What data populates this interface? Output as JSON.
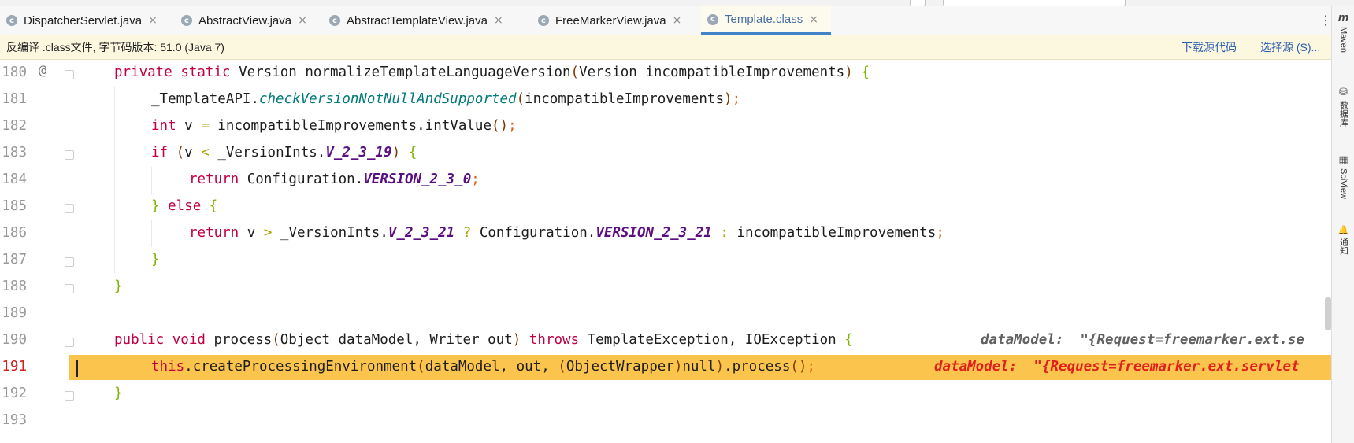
{
  "tabs": [
    {
      "label": "DispatcherServlet.java",
      "icon": "class-c-icon",
      "active": false
    },
    {
      "label": "AbstractView.java",
      "icon": "class-c-icon",
      "active": false
    },
    {
      "label": "AbstractTemplateView.java",
      "icon": "class-c-icon",
      "active": false
    },
    {
      "label": "FreeMarkerView.java",
      "icon": "class-c-icon",
      "active": false
    },
    {
      "label": "Template.class",
      "icon": "class-c-icon",
      "active": true
    }
  ],
  "tab_close_glyph": "×",
  "tab_menu_glyph": "⋮",
  "infobar": {
    "message": "反编译 .class文件, 字节码版本: 51.0 (Java 7)",
    "download_link": "下载源代码",
    "choose_link": "选择源 (S)..."
  },
  "right_tools": [
    {
      "label": "Maven",
      "icon": "maven-icon",
      "glyph": "m"
    },
    {
      "label": "数据库",
      "icon": "database-icon",
      "glyph": "⛁"
    },
    {
      "label": "SciView",
      "icon": "sciview-icon",
      "glyph": "▦"
    },
    {
      "label": "通知",
      "icon": "bell-icon",
      "glyph": "🔔"
    }
  ],
  "gutter_marker": "@",
  "lines": [
    {
      "num": "180",
      "text": "private static Version normalizeTemplateLanguageVersion(Version incompatibleImprovements) {"
    },
    {
      "num": "181",
      "text": "_TemplateAPI.checkVersionNotNullAndSupported(incompatibleImprovements);"
    },
    {
      "num": "182",
      "text": "int v = incompatibleImprovements.intValue();"
    },
    {
      "num": "183",
      "text": "if (v < _VersionInts.V_2_3_19) {"
    },
    {
      "num": "184",
      "text": "return Configuration.VERSION_2_3_0;"
    },
    {
      "num": "185",
      "text": "} else {"
    },
    {
      "num": "186",
      "text": "return v > _VersionInts.V_2_3_21 ? Configuration.VERSION_2_3_21 : incompatibleImprovements;"
    },
    {
      "num": "187",
      "text": "}"
    },
    {
      "num": "188",
      "text": "}"
    },
    {
      "num": "189",
      "text": ""
    },
    {
      "num": "190",
      "text": "public void process(Object dataModel, Writer out) throws TemplateException, IOException {"
    },
    {
      "num": "191",
      "text": "this.createProcessingEnvironment(dataModel, out, (ObjectWrapper)null).process();"
    },
    {
      "num": "192",
      "text": "}"
    },
    {
      "num": "193",
      "text": ""
    }
  ],
  "inlay_190": "dataModel:  \"{Request=freemarker.ext.se",
  "inlay_191": "dataModel:  \"{Request=freemarker.ext.servlet",
  "colors": {
    "highlight": "#fbc44c",
    "keyword": "#c20040",
    "constant": "#5a0f82",
    "link": "#2a5db0"
  }
}
